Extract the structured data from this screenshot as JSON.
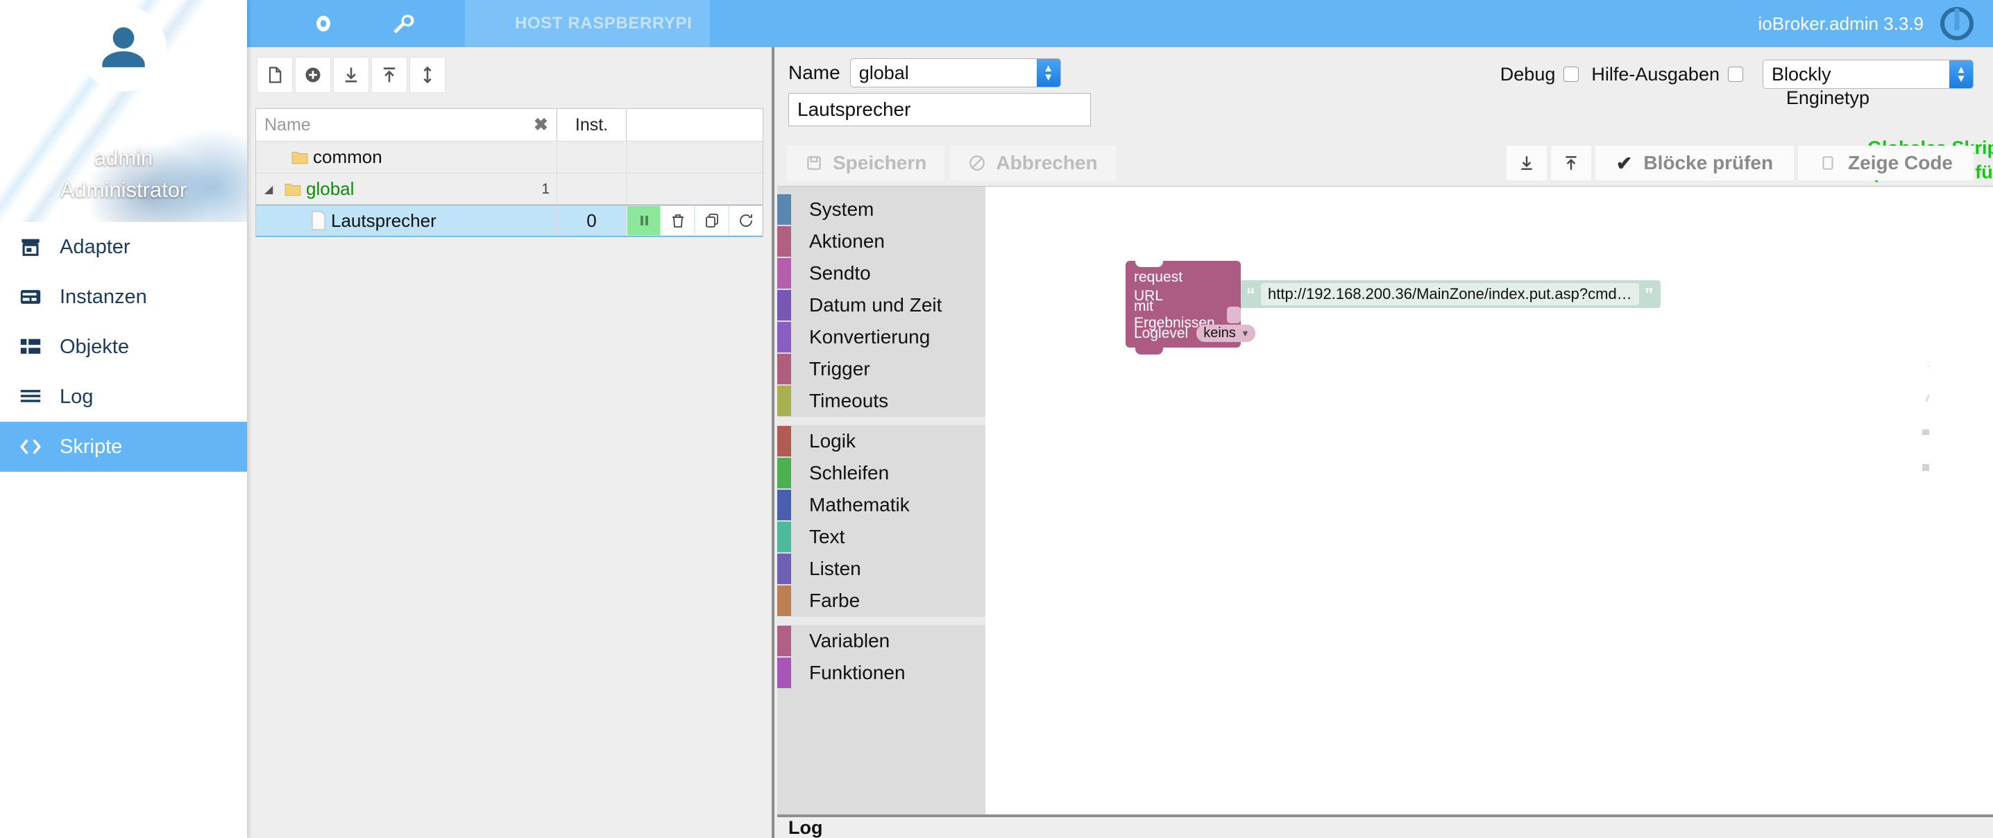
{
  "sidebar": {
    "user": "admin",
    "role": "Administrator",
    "items": [
      {
        "label": "Adapter",
        "icon": "store-icon",
        "active": false
      },
      {
        "label": "Instanzen",
        "icon": "card-icon",
        "active": false
      },
      {
        "label": "Objekte",
        "icon": "grid-icon",
        "active": false
      },
      {
        "label": "Log",
        "icon": "lines-icon",
        "active": false
      },
      {
        "label": "Skripte",
        "icon": "code-brackets-icon",
        "active": true
      }
    ]
  },
  "topbar": {
    "host_button": "HOST RASPBERRYPI",
    "version": "ioBroker.admin 3.3.9"
  },
  "tree": {
    "columns": {
      "name": "Name",
      "inst": "Inst."
    },
    "clear_filter": "✖",
    "rows": [
      {
        "name": "common",
        "type": "folder",
        "indent": 1,
        "count": "",
        "inst": "",
        "selected": false,
        "expanded": false,
        "green": false
      },
      {
        "name": "global",
        "type": "folder",
        "indent": 1,
        "count": "1",
        "inst": "",
        "selected": false,
        "expanded": true,
        "green": true
      },
      {
        "name": "Lautsprecher",
        "type": "script",
        "indent": 2,
        "count": "",
        "inst": "0",
        "selected": true,
        "expanded": false,
        "green": false
      }
    ],
    "row_actions": [
      "pause-button",
      "delete-button",
      "copy-button",
      "restart-button"
    ],
    "toolbar": [
      "new-script-icon",
      "add-folder-icon",
      "import-icon",
      "export-icon",
      "expand-collapse-icon"
    ]
  },
  "editor": {
    "name_label": "Name",
    "folder_value": "global",
    "script_name": "Lautsprecher",
    "save_label": "Speichern",
    "cancel_label": "Abbrechen",
    "global_help": "Globales Skript (klicke hier für Hilfe)",
    "debug_label": "Debug",
    "help_output_label": "Hilfe-Ausgaben",
    "engine_value": "Blockly",
    "engine_label": "Enginetyp",
    "check_blocks_label": "Blöcke prüfen",
    "show_code_label": "Zeige Code"
  },
  "blockly": {
    "categories": [
      {
        "label": "System",
        "color": "#5b86b0"
      },
      {
        "label": "Aktionen",
        "color": "#b1607f"
      },
      {
        "label": "Sendto",
        "color": "#b35fae"
      },
      {
        "label": "Datum und Zeit",
        "color": "#7658b4"
      },
      {
        "label": "Konvertierung",
        "color": "#8a5ec0"
      },
      {
        "label": "Trigger",
        "color": "#b05e7d"
      },
      {
        "label": "Timeouts",
        "color": "#a8b052"
      },
      {
        "sep": true
      },
      {
        "label": "Logik",
        "color": "#b25b52"
      },
      {
        "label": "Schleifen",
        "color": "#4caf50"
      },
      {
        "label": "Mathematik",
        "color": "#4a5fb0"
      },
      {
        "label": "Text",
        "color": "#4dbb9b"
      },
      {
        "label": "Listen",
        "color": "#6f5fb5"
      },
      {
        "label": "Farbe",
        "color": "#bb7f51"
      },
      {
        "sep": true
      },
      {
        "label": "Variablen",
        "color": "#b05f85"
      },
      {
        "label": "Funktionen",
        "color": "#a855b8"
      }
    ],
    "request_block": {
      "title": "request",
      "url_label": "URL",
      "with_results_label": "mit Ergebnissen",
      "loglevel_label": "Loglevel",
      "loglevel_value": "keins",
      "color": "#ac5b83"
    },
    "text_block": {
      "value": "http://192.168.200.36/MainZone/index.put.asp?cmd…",
      "color": "#c3ddd2"
    },
    "controls": [
      "center-workspace-icon",
      "zoom-in-icon",
      "zoom-out-icon",
      "trash-icon"
    ]
  },
  "log": {
    "title": "Log"
  }
}
